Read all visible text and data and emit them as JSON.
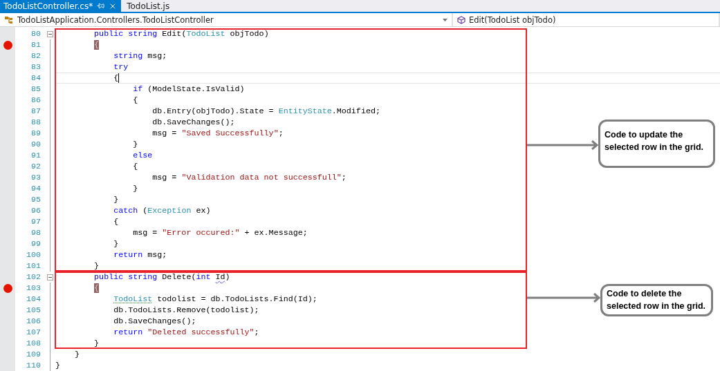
{
  "tabs": [
    {
      "label": "TodoListController.cs*",
      "selected": true,
      "pinned": true
    },
    {
      "label": "TodoList.js",
      "selected": false,
      "pinned": false
    }
  ],
  "navigation": {
    "type_dropdown": "TodoListApplication.Controllers.TodoListController",
    "member_dropdown": "Edit(TodoList objTodo)"
  },
  "lines": [
    {
      "number": "80",
      "breakpoint": false,
      "fold_start": true,
      "current": false,
      "tokens": [
        {
          "text": "        public",
          "kind": "keyword"
        },
        {
          "text": " string",
          "kind": "keyword"
        },
        {
          "text": " Edit(",
          "kind": "plain"
        },
        {
          "text": "TodoList",
          "kind": "type"
        },
        {
          "text": " objTodo)",
          "kind": "plain"
        }
      ]
    },
    {
      "number": "81",
      "breakpoint": true,
      "fold_start": false,
      "current": false,
      "tokens": [
        {
          "text": "        {",
          "kind": "brace-match"
        }
      ]
    },
    {
      "number": "82",
      "breakpoint": false,
      "fold_start": false,
      "current": false,
      "tokens": [
        {
          "text": "            string",
          "kind": "keyword"
        },
        {
          "text": " msg;",
          "kind": "plain"
        }
      ]
    },
    {
      "number": "83",
      "breakpoint": false,
      "fold_start": false,
      "current": false,
      "tokens": [
        {
          "text": "            try",
          "kind": "keyword"
        }
      ]
    },
    {
      "number": "84",
      "breakpoint": false,
      "fold_start": false,
      "current": true,
      "tokens": [
        {
          "text": "            {",
          "kind": "plain"
        }
      ]
    },
    {
      "number": "85",
      "breakpoint": false,
      "fold_start": false,
      "current": false,
      "tokens": [
        {
          "text": "                if",
          "kind": "keyword"
        },
        {
          "text": " (ModelState.IsValid)",
          "kind": "plain"
        }
      ]
    },
    {
      "number": "86",
      "breakpoint": false,
      "fold_start": false,
      "current": false,
      "tokens": [
        {
          "text": "                {",
          "kind": "plain"
        }
      ]
    },
    {
      "number": "87",
      "breakpoint": false,
      "fold_start": false,
      "current": false,
      "tokens": [
        {
          "text": "                    db.Entry(objTodo).State = ",
          "kind": "plain"
        },
        {
          "text": "EntityState",
          "kind": "type"
        },
        {
          "text": ".Modified;",
          "kind": "plain"
        }
      ]
    },
    {
      "number": "88",
      "breakpoint": false,
      "fold_start": false,
      "current": false,
      "tokens": [
        {
          "text": "                    db.SaveChanges();",
          "kind": "plain"
        }
      ]
    },
    {
      "number": "89",
      "breakpoint": false,
      "fold_start": false,
      "current": false,
      "tokens": [
        {
          "text": "                    msg = ",
          "kind": "plain"
        },
        {
          "text": "\"Saved Successfully\"",
          "kind": "string"
        },
        {
          "text": ";",
          "kind": "plain"
        }
      ]
    },
    {
      "number": "90",
      "breakpoint": false,
      "fold_start": false,
      "current": false,
      "tokens": [
        {
          "text": "                }",
          "kind": "plain"
        }
      ]
    },
    {
      "number": "91",
      "breakpoint": false,
      "fold_start": false,
      "current": false,
      "tokens": [
        {
          "text": "                else",
          "kind": "keyword"
        }
      ]
    },
    {
      "number": "92",
      "breakpoint": false,
      "fold_start": false,
      "current": false,
      "tokens": [
        {
          "text": "                {",
          "kind": "plain"
        }
      ]
    },
    {
      "number": "93",
      "breakpoint": false,
      "fold_start": false,
      "current": false,
      "tokens": [
        {
          "text": "                    msg = ",
          "kind": "plain"
        },
        {
          "text": "\"Validation data not successfull\"",
          "kind": "string"
        },
        {
          "text": ";",
          "kind": "plain"
        }
      ]
    },
    {
      "number": "94",
      "breakpoint": false,
      "fold_start": false,
      "current": false,
      "tokens": [
        {
          "text": "                }",
          "kind": "plain"
        }
      ]
    },
    {
      "number": "95",
      "breakpoint": false,
      "fold_start": false,
      "current": false,
      "tokens": [
        {
          "text": "            }",
          "kind": "plain"
        }
      ]
    },
    {
      "number": "96",
      "breakpoint": false,
      "fold_start": false,
      "current": false,
      "tokens": [
        {
          "text": "            catch",
          "kind": "keyword"
        },
        {
          "text": " (",
          "kind": "plain"
        },
        {
          "text": "Exception",
          "kind": "type"
        },
        {
          "text": " ex)",
          "kind": "plain"
        }
      ]
    },
    {
      "number": "97",
      "breakpoint": false,
      "fold_start": false,
      "current": false,
      "tokens": [
        {
          "text": "            {",
          "kind": "plain"
        }
      ]
    },
    {
      "number": "98",
      "breakpoint": false,
      "fold_start": false,
      "current": false,
      "tokens": [
        {
          "text": "                msg = ",
          "kind": "plain"
        },
        {
          "text": "\"Error occured:\"",
          "kind": "string"
        },
        {
          "text": " + ex.Message;",
          "kind": "plain"
        }
      ]
    },
    {
      "number": "99",
      "breakpoint": false,
      "fold_start": false,
      "current": false,
      "tokens": [
        {
          "text": "            }",
          "kind": "plain"
        }
      ]
    },
    {
      "number": "100",
      "breakpoint": false,
      "fold_start": false,
      "current": false,
      "tokens": [
        {
          "text": "            return",
          "kind": "keyword"
        },
        {
          "text": " msg;",
          "kind": "plain"
        }
      ]
    },
    {
      "number": "101",
      "breakpoint": false,
      "fold_start": false,
      "current": false,
      "tokens": [
        {
          "text": "        }",
          "kind": "plain"
        }
      ]
    },
    {
      "number": "102",
      "breakpoint": false,
      "fold_start": true,
      "current": false,
      "tokens": [
        {
          "text": "        public",
          "kind": "keyword"
        },
        {
          "text": " string",
          "kind": "keyword"
        },
        {
          "text": " Delete(",
          "kind": "plain"
        },
        {
          "text": "int",
          "kind": "keyword"
        },
        {
          "text": " Id",
          "kind": "plain-squiggle"
        },
        {
          "text": ")",
          "kind": "plain"
        }
      ]
    },
    {
      "number": "103",
      "breakpoint": true,
      "fold_start": false,
      "current": false,
      "tokens": [
        {
          "text": "        {",
          "kind": "brace-match"
        }
      ]
    },
    {
      "number": "104",
      "breakpoint": false,
      "fold_start": false,
      "current": false,
      "tokens": [
        {
          "text": "            TodoList",
          "kind": "type-squiggle"
        },
        {
          "text": " todolist = db.TodoLists.Find(Id);",
          "kind": "plain"
        }
      ]
    },
    {
      "number": "105",
      "breakpoint": false,
      "fold_start": false,
      "current": false,
      "tokens": [
        {
          "text": "            db.TodoLists.Remove(todolist);",
          "kind": "plain"
        }
      ]
    },
    {
      "number": "106",
      "breakpoint": false,
      "fold_start": false,
      "current": false,
      "tokens": [
        {
          "text": "            db.SaveChanges();",
          "kind": "plain"
        }
      ]
    },
    {
      "number": "107",
      "breakpoint": false,
      "fold_start": false,
      "current": false,
      "tokens": [
        {
          "text": "            return",
          "kind": "keyword"
        },
        {
          "text": " \"Deleted successfully\"",
          "kind": "string"
        },
        {
          "text": ";",
          "kind": "plain"
        }
      ]
    },
    {
      "number": "108",
      "breakpoint": false,
      "fold_start": false,
      "current": false,
      "tokens": [
        {
          "text": "        }",
          "kind": "plain"
        }
      ]
    },
    {
      "number": "109",
      "breakpoint": false,
      "fold_start": false,
      "current": false,
      "tokens": [
        {
          "text": "    }",
          "kind": "plain"
        }
      ]
    },
    {
      "number": "110",
      "breakpoint": false,
      "fold_start": false,
      "current": false,
      "tokens": [
        {
          "text": "}",
          "kind": "plain"
        }
      ]
    }
  ],
  "annotations": [
    {
      "text": "Code to update the selected row in the grid."
    },
    {
      "text": "Code to delete the selected row in the grid."
    }
  ]
}
